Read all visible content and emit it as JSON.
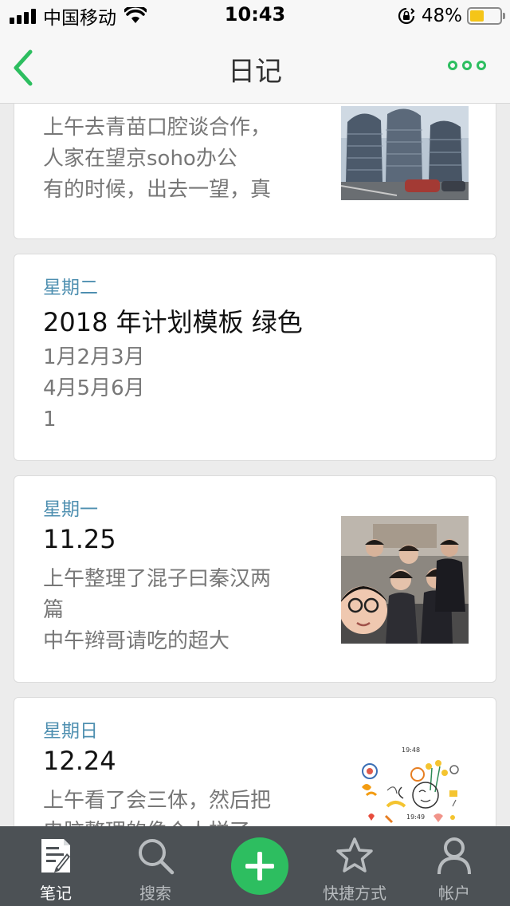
{
  "status_bar": {
    "carrier": "中国移动",
    "time": "10:43",
    "battery": "48%",
    "battery_level": 0.48,
    "icons": [
      "signal-icon",
      "wifi-icon",
      "orientation-lock-icon",
      "battery-icon"
    ]
  },
  "nav": {
    "title": "日记",
    "back_icon": "chevron-left-icon",
    "more_icon": "more-dots-icon",
    "accent_color": "#2dbe60"
  },
  "notes": [
    {
      "day": "",
      "title": "",
      "snippet": [
        "上午去青苗口腔谈合作，",
        "人家在望京soho办公",
        "有的时候，出去一望，真"
      ],
      "thumbnail": "building-photo"
    },
    {
      "day": "星期二",
      "title": "2018 年计划模板 绿色",
      "snippet": [
        "1月2月3月",
        "4月5月6月",
        "1"
      ],
      "thumbnail": ""
    },
    {
      "day": "星期一",
      "title": "11.25",
      "snippet": [
        "上午整理了混子曰秦汉两",
        "篇",
        "中午辫哥请吃的超大"
      ],
      "thumbnail": "group-selfie-photo"
    },
    {
      "day": "星期日",
      "title": "12.24",
      "snippet": [
        "上午看了会三体，然后把",
        "电脑整理的像个人样了"
      ],
      "thumbnail": "sketch-note-image"
    }
  ],
  "sketch_text": {
    "time1": "19:48",
    "time2": "19:49"
  },
  "tabs": [
    {
      "label": "笔记",
      "icon": "note-icon",
      "active": true
    },
    {
      "label": "搜索",
      "icon": "search-icon",
      "active": false
    },
    {
      "label": "快捷方式",
      "icon": "star-icon",
      "active": false
    },
    {
      "label": "帐户",
      "icon": "account-icon",
      "active": false
    }
  ],
  "add_button_icon": "plus-icon"
}
